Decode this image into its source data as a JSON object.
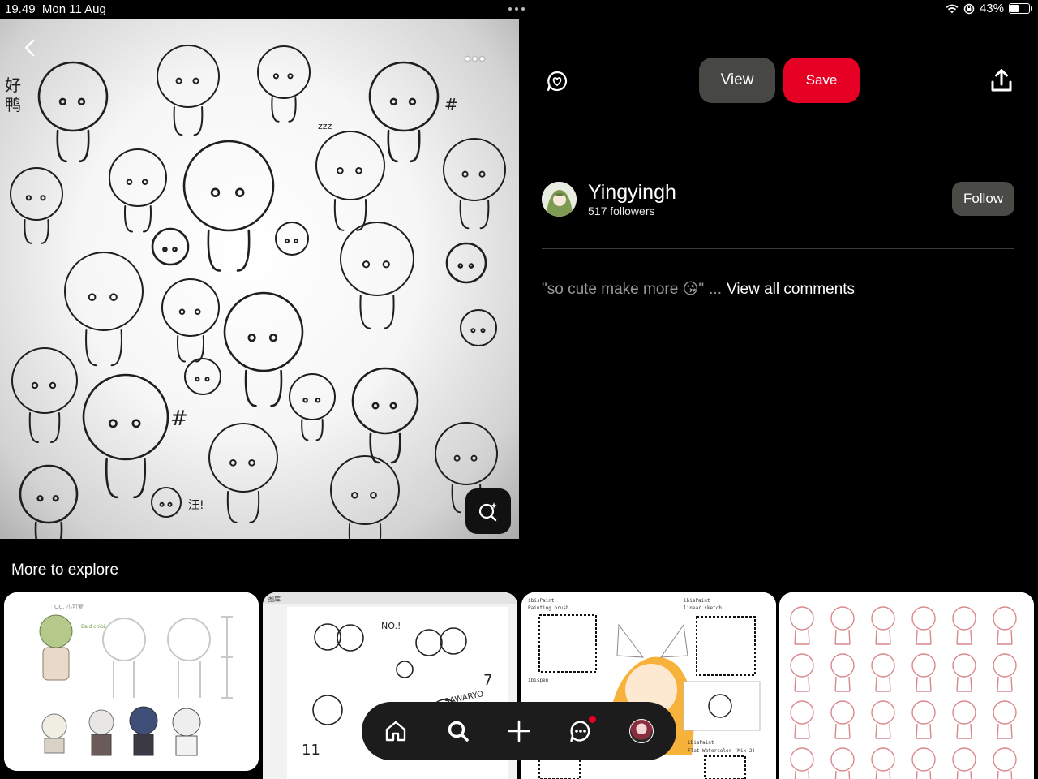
{
  "status_bar": {
    "time": "19.49",
    "date": "Mon 11 Aug",
    "battery_percent": "43%",
    "battery_level": 0.43
  },
  "pin": {
    "more_icon": "more-dots-icon",
    "back_icon": "chevron-left-icon",
    "lens_icon": "visual-search-icon",
    "image_text": [
      "好",
      "鸭",
      "#",
      "#",
      "zzz",
      "汪!"
    ]
  },
  "actions": {
    "comment_icon": "comment-icon",
    "view_label": "View",
    "save_label": "Save",
    "share_icon": "share-icon",
    "save_color": "#e60023"
  },
  "creator": {
    "name": "Yingyingh",
    "followers": "517 followers",
    "follow_label": "Follow"
  },
  "comment": {
    "text": "\"so cute make more 😘\"",
    "ellipsis": "...",
    "view_all": "View all comments"
  },
  "explore": {
    "heading": "More to explore",
    "tiles": [
      {
        "label_texts": [
          "OC, 小可爱",
          "Bald chibi"
        ]
      },
      {
        "label_texts": [
          "图库",
          "NO.!",
          "SAWARYO",
          "11",
          "7"
        ]
      },
      {
        "label_texts": [
          "ibisPaint",
          "Painting brush",
          "ibisPaint",
          "linear sketch",
          "ibispen",
          "ibisPaint",
          "Flat Watercolor (Mix 2)"
        ]
      },
      {
        "label_texts": []
      }
    ]
  },
  "nav": {
    "items": [
      "home-icon",
      "search-icon",
      "create-icon",
      "messages-icon",
      "profile-avatar"
    ],
    "has_notification": true
  }
}
